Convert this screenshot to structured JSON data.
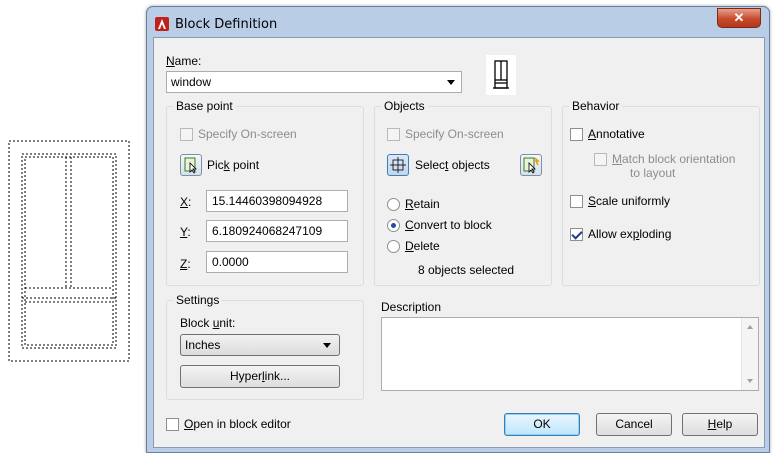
{
  "dialog": {
    "title": "Block Definition",
    "close_icon": "close-x-icon",
    "app_icon": "autocad-logo-icon"
  },
  "name": {
    "label_u": "N",
    "label_rest": "ame:",
    "value": "window"
  },
  "base_point": {
    "title": "Base point",
    "specify_onscreen": "Specify On-screen",
    "pick_point_pre": "Pic",
    "pick_point_u": "k",
    "pick_point_post": " point",
    "x_label": "X",
    "y_label": "Y",
    "z_label": "Z",
    "x_value": "15.14460398094928",
    "y_value": "6.180924068247109",
    "z_value": "0.0000"
  },
  "objects": {
    "title": "Objects",
    "specify_onscreen": "Specify On-screen",
    "select_objects_pre": "Selec",
    "select_objects_u": "t",
    "select_objects_post": " objects",
    "retain_u": "R",
    "retain_rest": "etain",
    "convert_u": "C",
    "convert_rest": "onvert to block",
    "delete_u": "D",
    "delete_rest": "elete",
    "selected_count": "8 objects selected",
    "selected_option": "convert"
  },
  "behavior": {
    "title": "Behavior",
    "annotative_u": "A",
    "annotative_rest": "nnotative",
    "match_u": "M",
    "match_rest": "atch block orientation",
    "match_line2": "to layout",
    "scale_u": "S",
    "scale_rest": "cale uniformly",
    "allow_pre": "Allow ex",
    "allow_u": "p",
    "allow_post": "loding",
    "annotative_checked": false,
    "scale_checked": false,
    "allow_checked": true
  },
  "settings": {
    "title": "Settings",
    "block_unit_pre": "Block ",
    "block_unit_u": "u",
    "block_unit_post": "nit:",
    "unit_value": "Inches",
    "hyperlink_pre": "Hyper",
    "hyperlink_u": "l",
    "hyperlink_post": "ink..."
  },
  "description": {
    "title": "Description"
  },
  "footer": {
    "open_editor_u": "O",
    "open_editor_rest": "pen in block editor",
    "ok": "OK",
    "cancel": "Cancel",
    "help_u": "H",
    "help_rest": "elp"
  }
}
